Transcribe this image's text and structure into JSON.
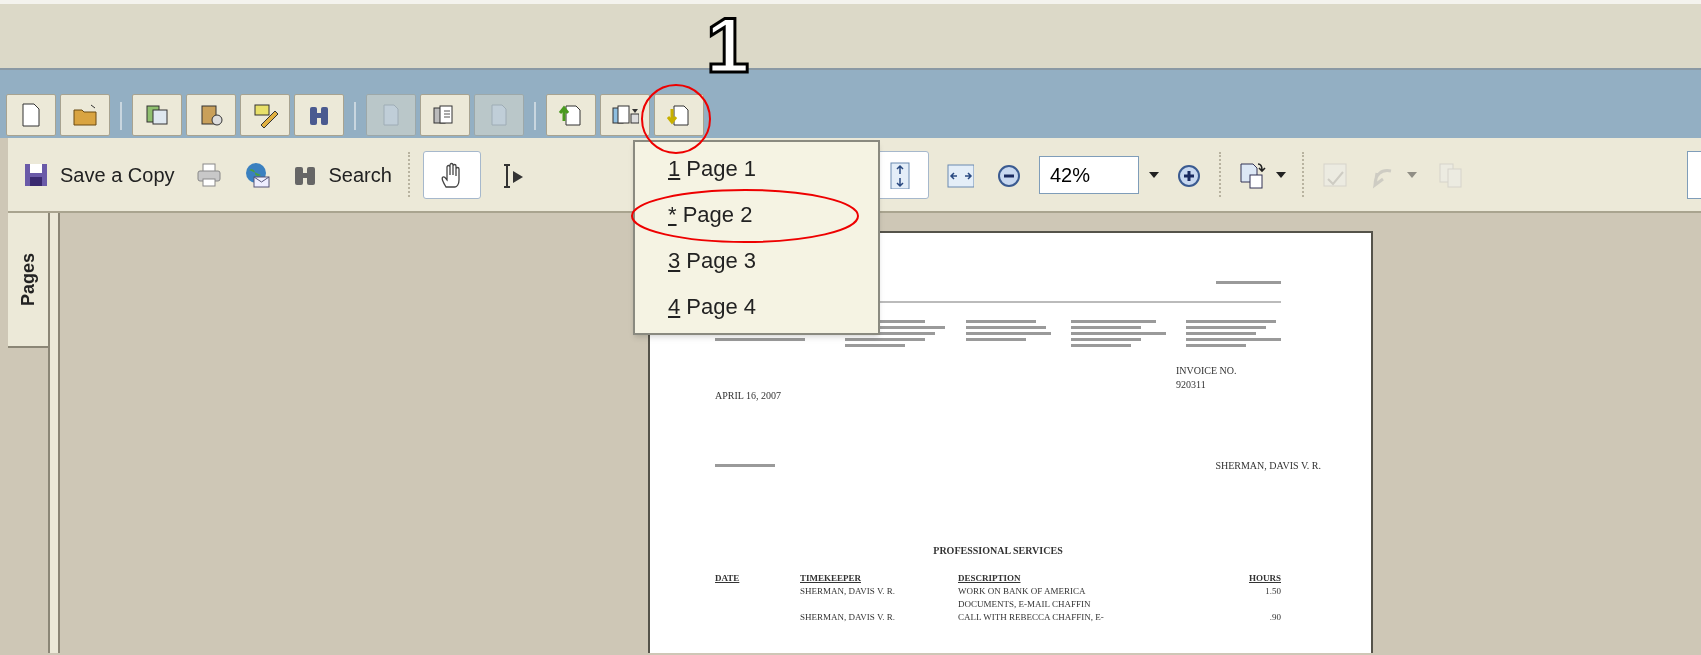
{
  "annotations": [
    {
      "kind": "number",
      "text": "1"
    },
    {
      "kind": "circle"
    },
    {
      "kind": "ellipse"
    }
  ],
  "toolbar_1": [
    {
      "kind": "new",
      "disabled": false
    },
    {
      "kind": "open",
      "disabled": false
    },
    {
      "kind": "sep"
    },
    {
      "kind": "organize",
      "disabled": false
    },
    {
      "kind": "attach",
      "disabled": false
    },
    {
      "kind": "comment",
      "disabled": false
    },
    {
      "kind": "find",
      "disabled": false
    },
    {
      "kind": "sep"
    },
    {
      "kind": "extract",
      "disabled": true
    },
    {
      "kind": "pages",
      "disabled": false
    },
    {
      "kind": "replace",
      "disabled": true
    },
    {
      "kind": "sep"
    },
    {
      "kind": "insert",
      "disabled": false
    },
    {
      "kind": "pagemenu",
      "disabled": false
    },
    {
      "kind": "export",
      "disabled": false
    }
  ],
  "toolbar_2": [
    {
      "kind": "save",
      "label": "Save a Copy"
    },
    {
      "kind": "print"
    },
    {
      "kind": "email"
    },
    {
      "kind": "search",
      "label": "Search"
    },
    {
      "kind": "sep"
    },
    {
      "kind": "hand",
      "selected": true
    },
    {
      "kind": "select",
      "selected": false
    },
    {
      "kind": "gap"
    },
    {
      "kind": "fitpage",
      "selected": true
    },
    {
      "kind": "fitwidth",
      "selected": false
    },
    {
      "kind": "zoomout"
    },
    {
      "kind": "zoom",
      "value": "42%"
    },
    {
      "kind": "zoomin"
    },
    {
      "kind": "sep"
    },
    {
      "kind": "rotate"
    },
    {
      "kind": "sep"
    },
    {
      "kind": "spell",
      "disabled": true
    },
    {
      "kind": "undo",
      "disabled": true
    },
    {
      "kind": "copy",
      "disabled": true
    }
  ],
  "page_menu": [
    {
      "key": "1",
      "label": "Page 1"
    },
    {
      "key": "*",
      "label": "Page 2"
    },
    {
      "key": "3",
      "label": "Page 3"
    },
    {
      "key": "4",
      "label": "Page 4"
    }
  ],
  "sidebar": {
    "tab": "Pages"
  },
  "document": {
    "invoice_label": "INVOICE NO.",
    "invoice_number": "920311",
    "date": "APRIL 16, 2007",
    "client": "SHERMAN, DAVIS V. R.",
    "section": "PROFESSIONAL SERVICES",
    "columns": [
      "DATE",
      "TIMEKEEPER",
      "DESCRIPTION",
      "HOURS"
    ],
    "rows": [
      {
        "timekeeper": "SHERMAN, DAVIS V. R.",
        "description": "WORK ON BANK OF AMERICA",
        "hours": "1.50"
      },
      {
        "description": "DOCUMENTS, E-MAIL CHAFFIN"
      },
      {
        "timekeeper": "SHERMAN, DAVIS V. R.",
        "description": "CALL WITH REBECCA CHAFFIN, E-",
        "hours": ".90"
      }
    ]
  }
}
